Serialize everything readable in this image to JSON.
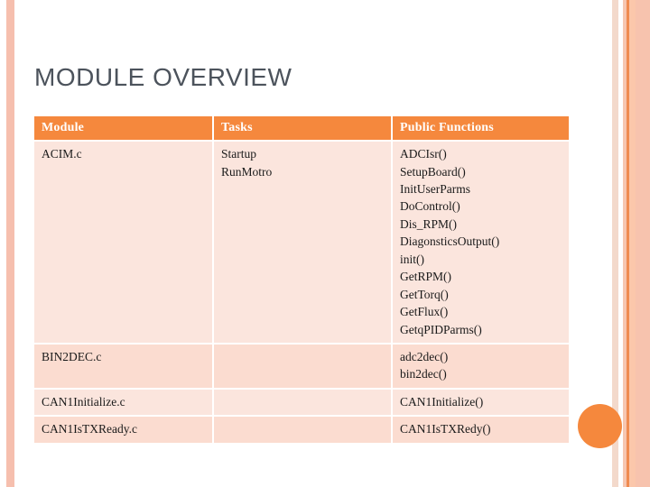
{
  "slide": {
    "title": "MODULE OVERVIEW",
    "accent_color": "#f5883d",
    "stripe_color": "#f6bfae",
    "row_color_a": "#fbe5dd",
    "row_color_b": "#fbdcd0",
    "title_color": "#4c535c"
  },
  "decor": {
    "dot_name": "orange-circle-decoration",
    "left_stripe_name": "left-edge-stripe",
    "right_stripes_name": "right-edge-stripes"
  },
  "table": {
    "headers": [
      "Module",
      "Tasks",
      "Public Functions"
    ],
    "rows": [
      {
        "module": "ACIM.c",
        "tasks": [
          "Startup",
          "RunMotro"
        ],
        "functions": [
          "ADCIsr()",
          "SetupBoard()",
          "InitUserParms",
          "DoControl()",
          "Dis_RPM()",
          "DiagonsticsOutput()",
          "init()",
          "GetRPM()",
          "GetTorq()",
          "GetFlux()",
          "GetqPIDParms()"
        ]
      },
      {
        "module": "BIN2DEC.c",
        "tasks": [],
        "functions": [
          "adc2dec()",
          "bin2dec()"
        ]
      },
      {
        "module": "CAN1Initialize.c",
        "tasks": [],
        "functions": [
          "CAN1Initialize()"
        ]
      },
      {
        "module": "CAN1IsTXReady.c",
        "tasks": [],
        "functions": [
          "CAN1IsTXRedy()"
        ]
      }
    ]
  }
}
